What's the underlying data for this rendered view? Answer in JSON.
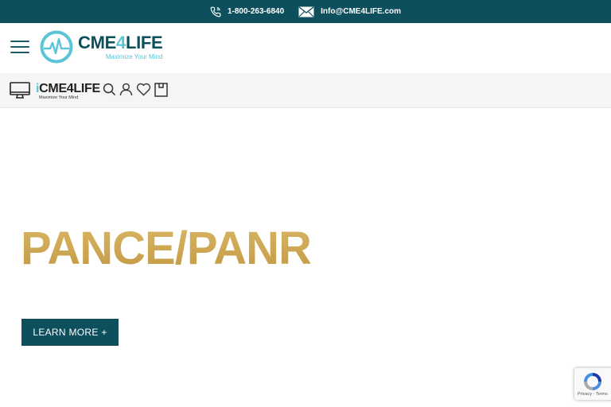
{
  "topbar": {
    "phone": "1-800-263-6840",
    "email": "Info@CME4LIFE.com",
    "phone_icon": "phone-icon",
    "email_icon": "envelope-icon"
  },
  "header": {
    "menu_icon": "hamburger-menu-icon",
    "logo": {
      "brand_prefix": "CME",
      "brand_four": "4",
      "brand_suffix": "LIFE",
      "tagline": "Maximize Your Mind",
      "icon": "heartbeat-logo-icon"
    }
  },
  "subbar": {
    "monitor_icon": "desktop-monitor-icon",
    "logo": {
      "brand_i": "i",
      "brand_rest": "CME4LIFE",
      "tagline": "Maximize Your Mind"
    },
    "icons": [
      "search-icon",
      "user-icon",
      "heart-icon",
      "shopping-bag-icon"
    ]
  },
  "hero": {
    "title": "PANCE/PANR",
    "button_label": "LEARN MORE +"
  },
  "recaptcha": {
    "terms": "Privacy - Terms"
  },
  "colors": {
    "primary": "#0d4f5c",
    "accent": "#5bc4d6",
    "gold": "#c9a54e"
  }
}
